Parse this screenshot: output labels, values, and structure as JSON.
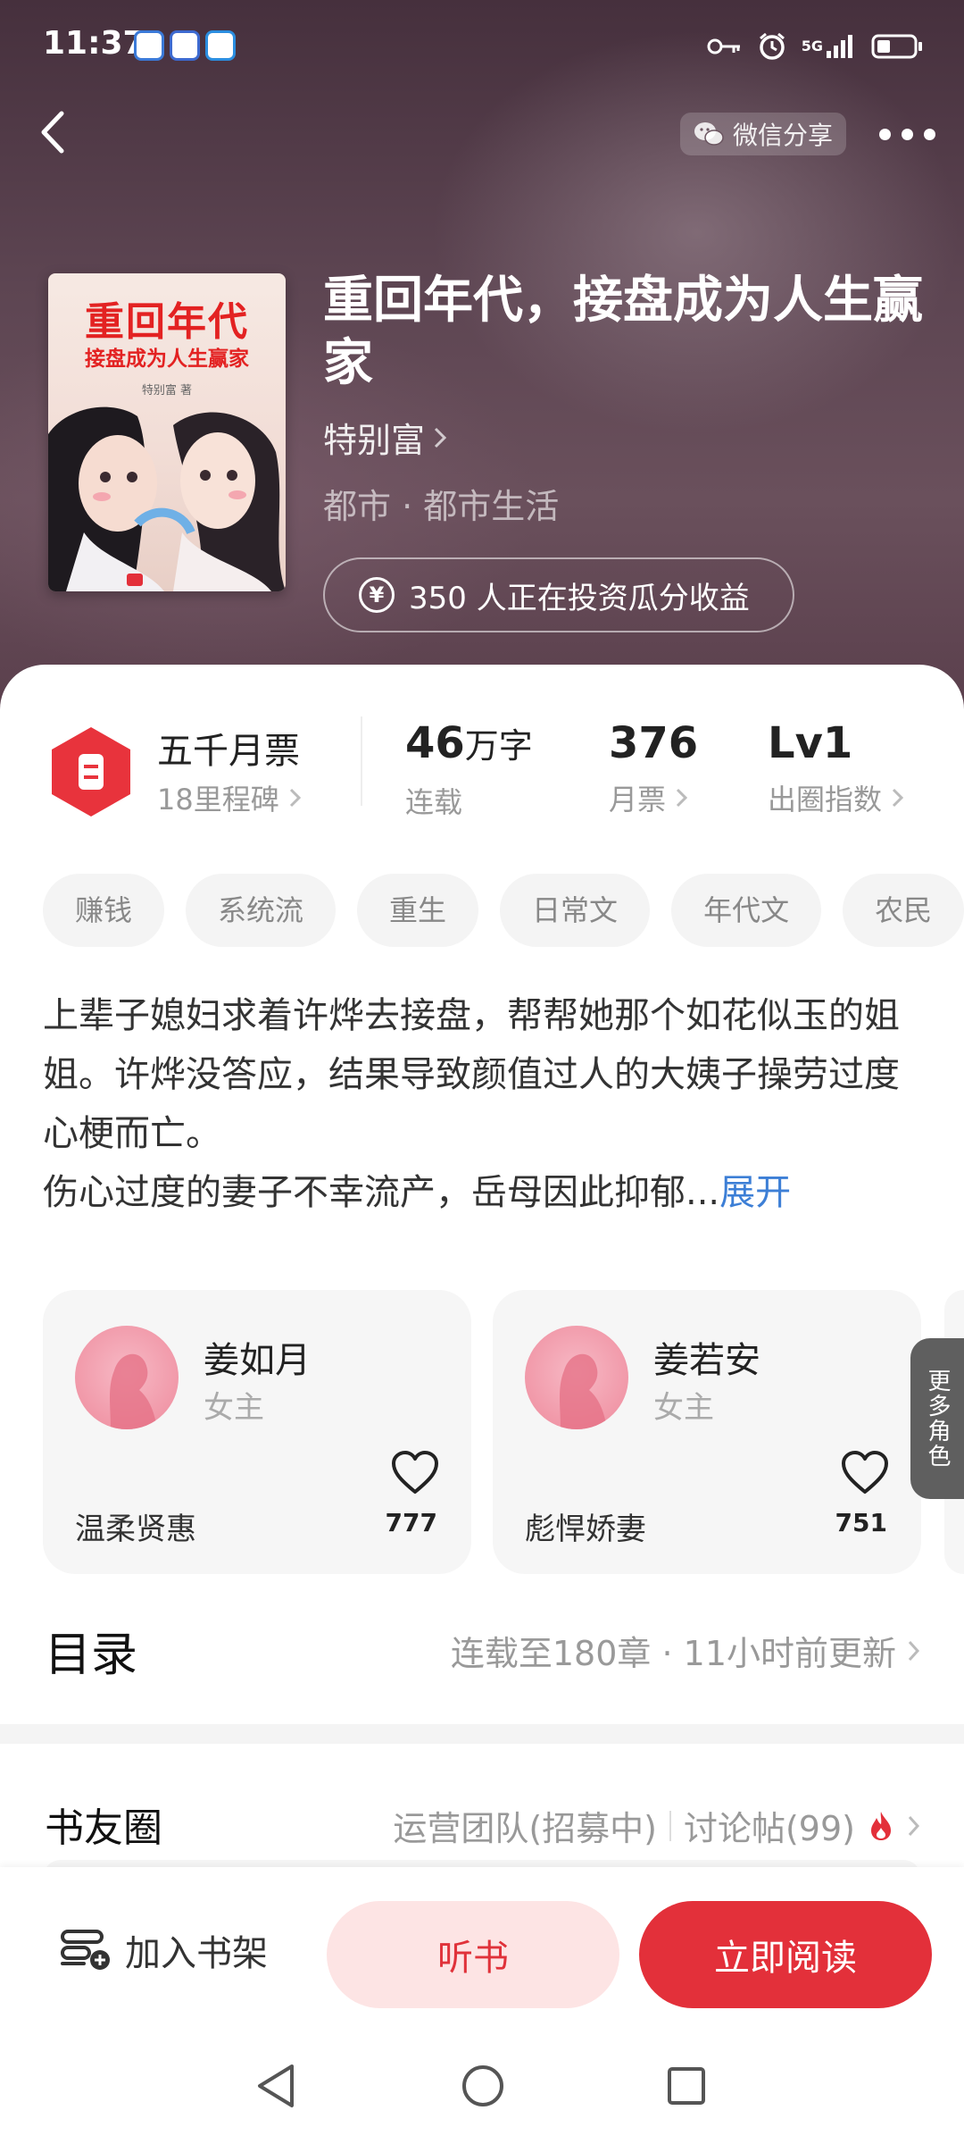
{
  "status_bar": {
    "time": "11:37",
    "network_label": "5G",
    "icons": [
      "key-icon",
      "alarm-icon",
      "signal-icon",
      "battery-icon"
    ]
  },
  "nav": {
    "share_label": "微信分享"
  },
  "book": {
    "title": "重回年代，接盘成为人生赢家",
    "author": "特别富",
    "genre": "都市 · 都市生活",
    "invest_text": "350 人正在投资瓜分收益",
    "invest_icon_glyph": "¥",
    "cover": {
      "title": "重回年代",
      "subtitle": "接盘成为人生赢家",
      "author": "特别富 著"
    }
  },
  "stats": {
    "badge_title": "五千月票",
    "badge_sub": "18里程碑",
    "words_value": "46",
    "words_unit": "万字",
    "words_label": "连载",
    "votes_value": "376",
    "votes_label": "月票",
    "level_value": "Lv1",
    "level_label": "出圈指数"
  },
  "tags": [
    "赚钱",
    "系统流",
    "重生",
    "日常文",
    "年代文",
    "农民"
  ],
  "synopsis": {
    "text": "上辈子媳妇求着许烨去接盘，帮帮她那个如花似玉的姐姐。许烨没答应，结果导致颜值过人的大姨子操劳过度心梗而亡。\n伤心过度的妻子不幸流产，岳母因此抑郁...",
    "expand_label": "展开"
  },
  "characters": [
    {
      "name": "姜如月",
      "role": "女主",
      "desc": "温柔贤惠",
      "likes": "777"
    },
    {
      "name": "姜若安",
      "role": "女主",
      "desc": "彪悍娇妻",
      "likes": "751"
    }
  ],
  "more_roles_label": "更多角色",
  "catalog": {
    "title": "目录",
    "info": "连载至180章 · 11小时前更新"
  },
  "circle": {
    "title": "书友圈",
    "team": "运营团队(招募中)",
    "posts": "讨论帖(99)"
  },
  "actions": {
    "add_shelf": "加入书架",
    "listen": "听书",
    "read": "立即阅读"
  },
  "colors": {
    "accent_red": "#e3303a",
    "listen_bg": "#fde4e4",
    "link_blue": "#3d7fd6"
  }
}
